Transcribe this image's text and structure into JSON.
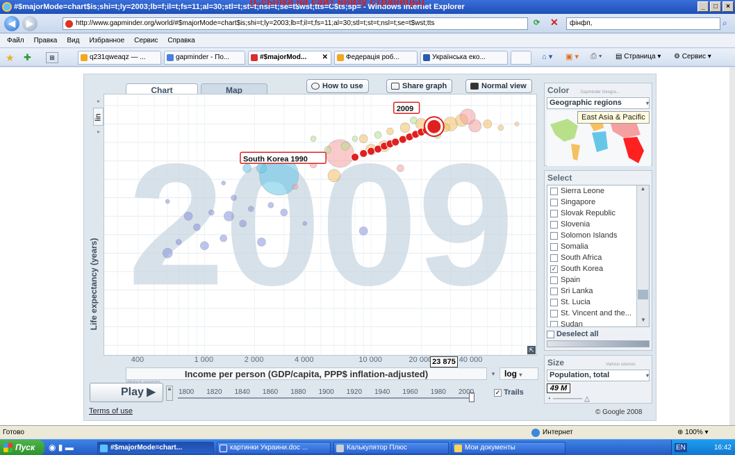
{
  "window": {
    "title": "#$majorMode=chart$is;shi=t;ly=2003;lb=f;il=t;fs=11;al=30;stl=t;st=t;nsl=t;se=t$wst;tts=C$ts;sp= - Windows Internet Explorer",
    "overlay_text": "(Ссылка на сайт внизу страницы)"
  },
  "address": {
    "url": "http://www.gapminder.org/world/#$majorMode=chart$is;shi=t;ly=2003;lb=f;il=t;fs=11;al=30;stl=t;st=t;nsl=t;se=t$wst;tts",
    "search": "фінфп,"
  },
  "menu": [
    "Файл",
    "Правка",
    "Вид",
    "Избранное",
    "Сервис",
    "Справка"
  ],
  "browser_tabs": [
    {
      "label": "q231qweaqz — ...",
      "color": "#f0a820"
    },
    {
      "label": "gapminder - По...",
      "color": "#4a7fe0"
    },
    {
      "label": "#$majorMod...",
      "color": "#d83030"
    },
    {
      "label": "Федерація роб...",
      "color": "#f0a820"
    },
    {
      "label": "Українська еко...",
      "color": "#2a5ab0"
    }
  ],
  "browser_tools": {
    "page": "Страница",
    "service": "Сервис"
  },
  "app": {
    "tabs": {
      "chart": "Chart",
      "map": "Map"
    },
    "buttons": {
      "how_to_use": "How to use",
      "share": "Share graph",
      "normal_view": "Normal view"
    },
    "year_watermark": "2009",
    "y_scale": "lin",
    "y_marker": "80",
    "x_marker": "23 875",
    "x_scale": "log",
    "y_axis_label": "Life expectancy (years)",
    "x_axis_label": "Income per person (GDP/capita, PPP$ inflation-adjusted)",
    "various_sources": "Various sources",
    "play": "Play",
    "trails": "Trails",
    "terms": "Terms of use",
    "copyright": "© Google 2008",
    "color_panel": {
      "title": "Color",
      "credit": "Gapminder Geogra...",
      "value": "Geographic regions",
      "tooltip": "East Asia & Pacific"
    },
    "select_panel": {
      "title": "Select",
      "deselect": "Deselect all",
      "items": [
        {
          "label": "Sierra Leone",
          "checked": false
        },
        {
          "label": "Singapore",
          "checked": false
        },
        {
          "label": "Slovak Republic",
          "checked": false
        },
        {
          "label": "Slovenia",
          "checked": false
        },
        {
          "label": "Solomon Islands",
          "checked": false
        },
        {
          "label": "Somalia",
          "checked": false
        },
        {
          "label": "South Africa",
          "checked": false
        },
        {
          "label": "South Korea",
          "checked": true
        },
        {
          "label": "Spain",
          "checked": false
        },
        {
          "label": "Sri Lanka",
          "checked": false
        },
        {
          "label": "St. Lucia",
          "checked": false
        },
        {
          "label": "St. Vincent and the...",
          "checked": false
        },
        {
          "label": "Sudan",
          "checked": false
        }
      ]
    },
    "size_panel": {
      "title": "Size",
      "credit": "Various sources",
      "value": "Population, total",
      "marker": "49 M"
    }
  },
  "chart_data": {
    "type": "scatter",
    "title": "",
    "xlabel": "Income per person (GDP/capita, PPP$ inflation-adjusted)",
    "ylabel": "Life expectancy (years)",
    "x_scale": "log",
    "x_ticks": [
      "400",
      "1 000",
      "2 000",
      "4 000",
      "10 000",
      "20 000",
      "40 000"
    ],
    "y_ticks": [
      "20",
      "25",
      "30",
      "35",
      "40",
      "45",
      "50",
      "55",
      "60",
      "65",
      "70",
      "75",
      "80",
      "85"
    ],
    "timeline_ticks": [
      "1800",
      "1820",
      "1840",
      "1860",
      "1880",
      "1900",
      "1920",
      "1940",
      "1960",
      "1980",
      "2000"
    ],
    "labels": {
      "start": "South Korea 1990",
      "end": "2009"
    },
    "highlight_trail": {
      "name": "South Korea",
      "color": "#e02020",
      "points": [
        [
          8000,
          71
        ],
        [
          9000,
          72
        ],
        [
          10000,
          72.6
        ],
        [
          11000,
          73.2
        ],
        [
          12000,
          74
        ],
        [
          13000,
          74.6
        ],
        [
          14000,
          75.1
        ],
        [
          15500,
          75.8
        ],
        [
          17000,
          76.5
        ],
        [
          18500,
          77.2
        ],
        [
          20000,
          77.8
        ],
        [
          21500,
          78.3
        ],
        [
          23000,
          78.9
        ],
        [
          23875,
          79.3
        ]
      ]
    },
    "bubbles": [
      {
        "x": 600,
        "y": 45,
        "r": 7,
        "c": "#8b93dc"
      },
      {
        "x": 700,
        "y": 48,
        "r": 4,
        "c": "#8b93dc"
      },
      {
        "x": 800,
        "y": 55,
        "r": 6,
        "c": "#8b93dc"
      },
      {
        "x": 900,
        "y": 52,
        "r": 5,
        "c": "#8b93dc"
      },
      {
        "x": 1000,
        "y": 47,
        "r": 6,
        "c": "#8b93dc"
      },
      {
        "x": 1100,
        "y": 56,
        "r": 4,
        "c": "#8b93dc"
      },
      {
        "x": 1300,
        "y": 49,
        "r": 5,
        "c": "#8b93dc"
      },
      {
        "x": 1400,
        "y": 55,
        "r": 7,
        "c": "#8b93dc"
      },
      {
        "x": 1500,
        "y": 60,
        "r": 4,
        "c": "#8b93dc"
      },
      {
        "x": 1700,
        "y": 53,
        "r": 5,
        "c": "#8b93dc"
      },
      {
        "x": 1900,
        "y": 57,
        "r": 4,
        "c": "#8b93dc"
      },
      {
        "x": 2200,
        "y": 48,
        "r": 6,
        "c": "#8b93dc"
      },
      {
        "x": 2500,
        "y": 58,
        "r": 4,
        "c": "#8b93dc"
      },
      {
        "x": 3000,
        "y": 56,
        "r": 5,
        "c": "#8b93dc"
      },
      {
        "x": 4000,
        "y": 53,
        "r": 3,
        "c": "#8b93dc"
      },
      {
        "x": 9000,
        "y": 51,
        "r": 6,
        "c": "#8b93dc"
      },
      {
        "x": 600,
        "y": 59,
        "r": 3,
        "c": "#8b93dc"
      },
      {
        "x": 1300,
        "y": 64,
        "r": 3,
        "c": "#8b93dc"
      },
      {
        "x": 2800,
        "y": 66,
        "r": 28,
        "c": "#66c6e8"
      },
      {
        "x": 2200,
        "y": 68,
        "r": 7,
        "c": "#66c6e8"
      },
      {
        "x": 1800,
        "y": 68,
        "r": 6,
        "c": "#66c6e8"
      },
      {
        "x": 6500,
        "y": 72,
        "r": 20,
        "c": "#f5a0a0"
      },
      {
        "x": 4500,
        "y": 69,
        "r": 5,
        "c": "#f5a0a0"
      },
      {
        "x": 3500,
        "y": 63,
        "r": 4,
        "c": "#f5a0a0"
      },
      {
        "x": 10000,
        "y": 73,
        "r": 8,
        "c": "#f5c060"
      },
      {
        "x": 12000,
        "y": 74,
        "r": 8,
        "c": "#f5c060"
      },
      {
        "x": 9000,
        "y": 76,
        "r": 6,
        "c": "#f5c060"
      },
      {
        "x": 14000,
        "y": 75,
        "r": 5,
        "c": "#f5c060"
      },
      {
        "x": 15000,
        "y": 68,
        "r": 5,
        "c": "#f5a0a0"
      },
      {
        "x": 7000,
        "y": 74,
        "r": 6,
        "c": "#b8e08a"
      },
      {
        "x": 11000,
        "y": 77,
        "r": 5,
        "c": "#b8e08a"
      },
      {
        "x": 8000,
        "y": 76,
        "r": 4,
        "c": "#b8e08a"
      },
      {
        "x": 5500,
        "y": 73,
        "r": 5,
        "c": "#b8e08a"
      },
      {
        "x": 16000,
        "y": 79,
        "r": 7,
        "c": "#f5c060"
      },
      {
        "x": 20000,
        "y": 80,
        "r": 8,
        "c": "#f5c060"
      },
      {
        "x": 30000,
        "y": 80,
        "r": 10,
        "c": "#f5c060"
      },
      {
        "x": 35000,
        "y": 81,
        "r": 9,
        "c": "#f5c060"
      },
      {
        "x": 42000,
        "y": 79.5,
        "r": 9,
        "c": "#f5a0a0"
      },
      {
        "x": 38000,
        "y": 82,
        "r": 11,
        "c": "#f5a0a0"
      },
      {
        "x": 50000,
        "y": 80,
        "r": 6,
        "c": "#f5c060"
      },
      {
        "x": 28000,
        "y": 79,
        "r": 6,
        "c": "#f5c060"
      },
      {
        "x": 25000,
        "y": 77,
        "r": 5,
        "c": "#b8e08a"
      },
      {
        "x": 60000,
        "y": 79,
        "r": 4,
        "c": "#f5c060"
      },
      {
        "x": 75000,
        "y": 80,
        "r": 3,
        "c": "#f5c060"
      },
      {
        "x": 18000,
        "y": 81,
        "r": 5,
        "c": "#b8e08a"
      },
      {
        "x": 13000,
        "y": 78,
        "r": 5,
        "c": "#f5c060"
      },
      {
        "x": 22000,
        "y": 78,
        "r": 5,
        "c": "#b8e08a"
      },
      {
        "x": 4500,
        "y": 76,
        "r": 4,
        "c": "#b8e08a"
      },
      {
        "x": 3800,
        "y": 71,
        "r": 4,
        "c": "#66c6e8"
      },
      {
        "x": 6000,
        "y": 66,
        "r": 9,
        "c": "#f5c060"
      }
    ]
  },
  "status": {
    "left": "Готово",
    "zone": "Интернет",
    "zoom": "100%"
  },
  "taskbar": {
    "start": "Пуск",
    "items": [
      "#$majorMode=chart...",
      "картинки Украини.doc ...",
      "Калькулятор Плюс",
      "Мои документы"
    ],
    "lang": "EN",
    "clock": "16:42"
  }
}
